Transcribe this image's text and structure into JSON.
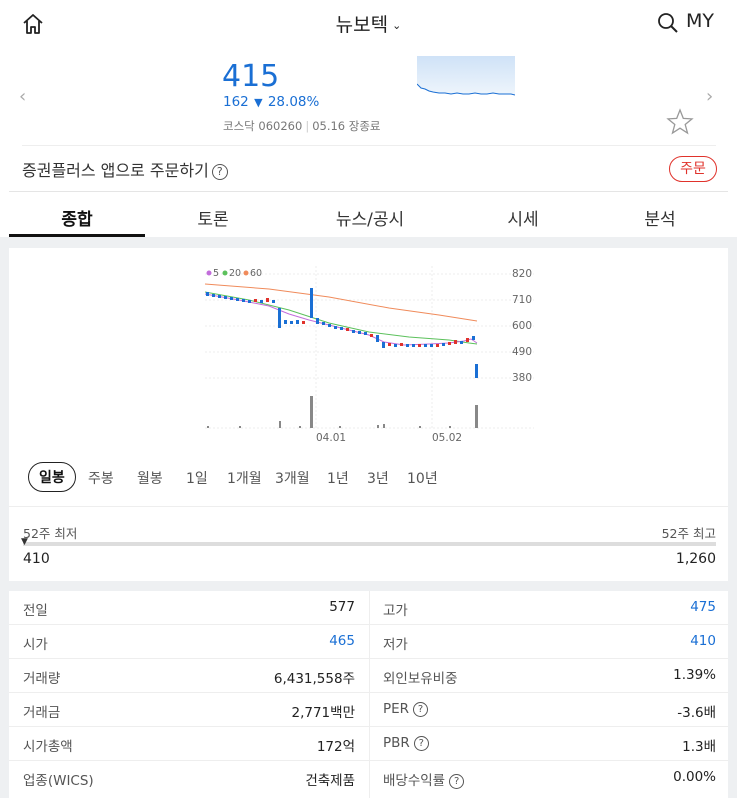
{
  "header": {
    "title": "뉴보텍",
    "my_label": "MY"
  },
  "quote": {
    "price": "415",
    "change_amount": "162",
    "change_percent": "28.08%",
    "market": "코스닥",
    "code": "060260",
    "date_status": "05.16 장종료",
    "direction": "down"
  },
  "order": {
    "text": "증권플러스 앱으로 주문하기",
    "button_label": "주문"
  },
  "tabs": [
    {
      "label": "종합",
      "active": true
    },
    {
      "label": "토론",
      "active": false
    },
    {
      "label": "뉴스/공시",
      "active": false
    },
    {
      "label": "시세",
      "active": false
    },
    {
      "label": "분석",
      "active": false
    }
  ],
  "chart": {
    "legend": [
      "5",
      "20",
      "60"
    ],
    "legend_colors": [
      "#c26ddb",
      "#5cc15c",
      "#f08b5b"
    ],
    "y_ticks": [
      "820",
      "710",
      "600",
      "490",
      "380"
    ],
    "x_ticks": [
      "04.01",
      "05.02"
    ]
  },
  "periods": [
    {
      "label": "일봉",
      "active": true
    },
    {
      "label": "주봉",
      "active": false
    },
    {
      "label": "월봉",
      "active": false
    },
    {
      "label": "1일",
      "active": false
    },
    {
      "label": "1개월",
      "active": false
    },
    {
      "label": "3개월",
      "active": false
    },
    {
      "label": "1년",
      "active": false
    },
    {
      "label": "3년",
      "active": false
    },
    {
      "label": "10년",
      "active": false
    }
  ],
  "range52": {
    "low_label": "52주 최저",
    "high_label": "52주 최고",
    "low_value": "410",
    "high_value": "1,260"
  },
  "stats": [
    {
      "left_label": "전일",
      "left_value": "577",
      "left_color": "normal",
      "right_label": "고가",
      "right_value": "475",
      "right_color": "blue"
    },
    {
      "left_label": "시가",
      "left_value": "465",
      "left_color": "blue",
      "right_label": "저가",
      "right_value": "410",
      "right_color": "blue"
    },
    {
      "left_label": "거래량",
      "left_value": "6,431,558주",
      "left_color": "normal",
      "right_label": "외인보유비중",
      "right_value": "1.39%",
      "right_color": "normal"
    },
    {
      "left_label": "거래금",
      "left_value": "2,771백만",
      "left_color": "normal",
      "right_label": "PER",
      "right_value": "-3.6배",
      "right_color": "normal"
    },
    {
      "left_label": "시가총액",
      "left_value": "172억",
      "left_color": "normal",
      "right_label": "PBR",
      "right_value": "1.3배",
      "right_color": "normal"
    },
    {
      "left_label": "업종(WICS)",
      "left_value": "건축제품",
      "left_color": "normal",
      "right_label": "배당수익률",
      "right_value": "0.00%",
      "right_color": "normal"
    }
  ],
  "colors": {
    "down": "#1a6fd4",
    "up": "#e0322b"
  }
}
